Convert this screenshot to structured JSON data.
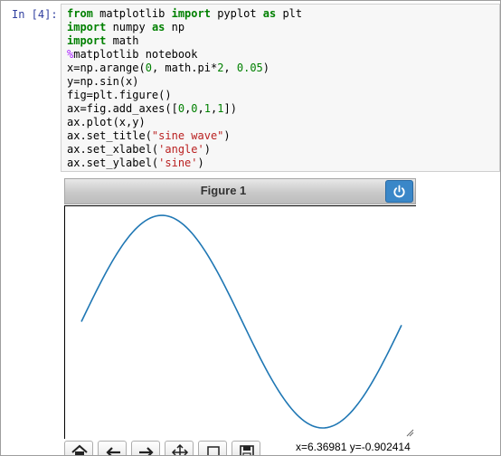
{
  "cell": {
    "prompt": "In [4]:",
    "code": [
      [
        {
          "t": "from",
          "c": "kw"
        },
        {
          "t": " matplotlib "
        },
        {
          "t": "import",
          "c": "kw"
        },
        {
          "t": " pyplot "
        },
        {
          "t": "as",
          "c": "kw"
        },
        {
          "t": " plt"
        }
      ],
      [
        {
          "t": "import",
          "c": "kw"
        },
        {
          "t": " numpy "
        },
        {
          "t": "as",
          "c": "kw"
        },
        {
          "t": " np"
        }
      ],
      [
        {
          "t": "import",
          "c": "kw"
        },
        {
          "t": " math"
        }
      ],
      [
        {
          "t": "%",
          "c": "mag"
        },
        {
          "t": "matplotlib notebook"
        }
      ],
      [
        {
          "t": "x=np.arange("
        },
        {
          "t": "0",
          "c": "num"
        },
        {
          "t": ", math.pi*"
        },
        {
          "t": "2",
          "c": "num"
        },
        {
          "t": ", "
        },
        {
          "t": "0.05",
          "c": "num"
        },
        {
          "t": ")"
        }
      ],
      [
        {
          "t": "y=np.sin(x)"
        }
      ],
      [
        {
          "t": "fig=plt.figure()"
        }
      ],
      [
        {
          "t": "ax=fig.add_axes(["
        },
        {
          "t": "0",
          "c": "num"
        },
        {
          "t": ","
        },
        {
          "t": "0",
          "c": "num"
        },
        {
          "t": ","
        },
        {
          "t": "1",
          "c": "num"
        },
        {
          "t": ","
        },
        {
          "t": "1",
          "c": "num"
        },
        {
          "t": "])"
        }
      ],
      [
        {
          "t": "ax.plot(x,y)"
        }
      ],
      [
        {
          "t": "ax.set_title("
        },
        {
          "t": "\"sine wave\"",
          "c": "str"
        },
        {
          "t": ")"
        }
      ],
      [
        {
          "t": "ax.set_xlabel("
        },
        {
          "t": "'angle'",
          "c": "str"
        },
        {
          "t": ")"
        }
      ],
      [
        {
          "t": "ax.set_ylabel("
        },
        {
          "t": "'sine'",
          "c": "str"
        },
        {
          "t": ")"
        }
      ]
    ]
  },
  "figure": {
    "title": "Figure 1",
    "coords_readout": "x=6.36981 y=-0.902414",
    "line_color": "#1f77b4",
    "power_button_color": "#3a87c8"
  },
  "toolbar": {
    "buttons": [
      {
        "name": "home-icon"
      },
      {
        "name": "back-arrow-icon"
      },
      {
        "name": "forward-arrow-icon"
      },
      {
        "name": "pan-move-icon"
      },
      {
        "name": "zoom-rect-icon"
      },
      {
        "name": "save-disk-icon"
      }
    ]
  },
  "chart_data": {
    "type": "line",
    "title": "",
    "xlabel": "",
    "ylabel": "",
    "xlim": [
      0,
      6.25
    ],
    "ylim": [
      -1,
      1
    ],
    "x_start": 0,
    "x_end": 6.25,
    "x_step": 0.05,
    "function": "sin",
    "series": [
      {
        "x": [
          0.0,
          0.25,
          0.5,
          0.75,
          1.0,
          1.25,
          1.5,
          1.75,
          2.0,
          2.25,
          2.5,
          2.75,
          3.0,
          3.25,
          3.5,
          3.75,
          4.0,
          4.25,
          4.5,
          4.75,
          5.0,
          5.25,
          5.5,
          5.75,
          6.0,
          6.25
        ],
        "y": [
          0.0,
          0.247,
          0.479,
          0.682,
          0.841,
          0.949,
          0.997,
          0.984,
          0.909,
          0.778,
          0.598,
          0.382,
          0.141,
          -0.108,
          -0.351,
          -0.572,
          -0.757,
          -0.895,
          -0.978,
          -0.999,
          -0.959,
          -0.859,
          -0.706,
          -0.508,
          -0.279,
          -0.033
        ]
      }
    ]
  }
}
